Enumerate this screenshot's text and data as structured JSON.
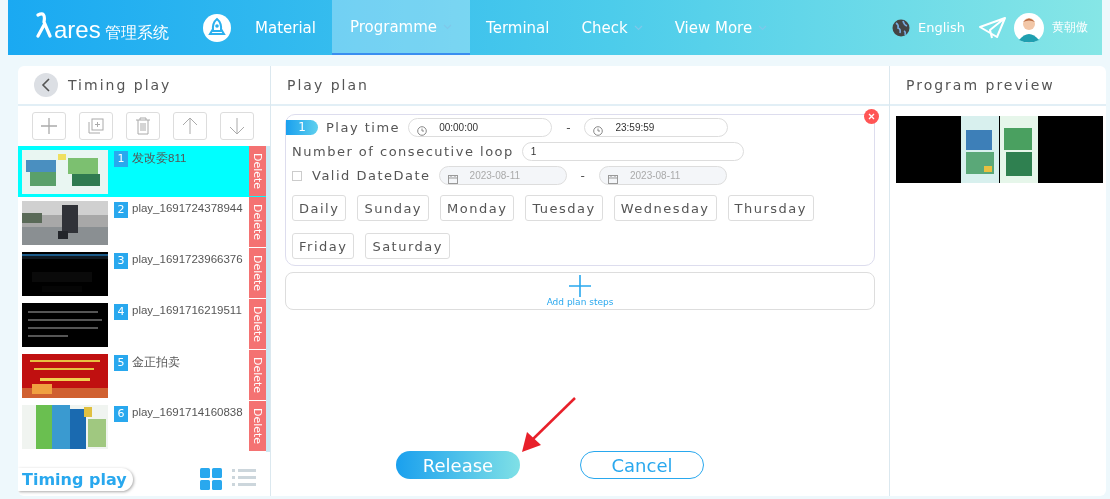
{
  "header": {
    "logo_brand": "ares",
    "logo_text": "管理系统",
    "nav": [
      {
        "label": "Material",
        "selected": false,
        "dropdown": false
      },
      {
        "label": "Programme",
        "selected": true,
        "dropdown": true
      },
      {
        "label": "Terminal",
        "selected": false,
        "dropdown": false
      },
      {
        "label": "Check",
        "selected": false,
        "dropdown": true
      },
      {
        "label": "View More",
        "selected": false,
        "dropdown": true
      }
    ],
    "language": "English",
    "user": "黄朝傲"
  },
  "left_panel": {
    "title": "Timing play",
    "items": [
      {
        "index": "1",
        "name": "发改委811",
        "selected": true,
        "kind": "poster",
        "delete": "Delete"
      },
      {
        "index": "2",
        "name": "play_1691724378944",
        "selected": false,
        "kind": "street",
        "delete": "Delete"
      },
      {
        "index": "3",
        "name": "play_1691723966376",
        "selected": false,
        "kind": "dark",
        "delete": "Delete"
      },
      {
        "index": "4",
        "name": "play_1691716219511",
        "selected": false,
        "kind": "darktext",
        "delete": "Delete"
      },
      {
        "index": "5",
        "name": "金正拍卖",
        "selected": false,
        "kind": "red",
        "delete": "Delete"
      },
      {
        "index": "6",
        "name": "play_1691714160838",
        "selected": false,
        "kind": "colorful",
        "delete": "Delete"
      }
    ],
    "floating_label": "Timing play",
    "view_grid": {
      "selected": true
    },
    "view_list": {
      "selected": false
    }
  },
  "plan": {
    "title": "Play plan",
    "steps": [
      {
        "index": "1",
        "play_time_label": "Play time",
        "start_time": "00:00:00",
        "end_time": "23:59:59",
        "separator": "-",
        "loop_label": "Number of consecutive loop",
        "loop_value": "1",
        "valid_date_label": "Valid Date",
        "valid_date_checked": false,
        "date_label": "Date",
        "start_date": "2023-08-11",
        "end_date": "2023-08-11",
        "date_separator": "-",
        "dates_disabled": true,
        "days": [
          {
            "label": "Daily",
            "selected": false
          },
          {
            "label": "Sunday",
            "selected": false
          },
          {
            "label": "Monday",
            "selected": false
          },
          {
            "label": "Tuesday",
            "selected": false
          },
          {
            "label": "Wednesday",
            "selected": false
          },
          {
            "label": "Thursday",
            "selected": false
          },
          {
            "label": "Friday",
            "selected": false
          },
          {
            "label": "Saturday",
            "selected": false
          }
        ]
      }
    ],
    "add_label": "Add plan steps",
    "release": "Release",
    "cancel": "Cancel"
  },
  "preview": {
    "title": "Program preview"
  }
}
